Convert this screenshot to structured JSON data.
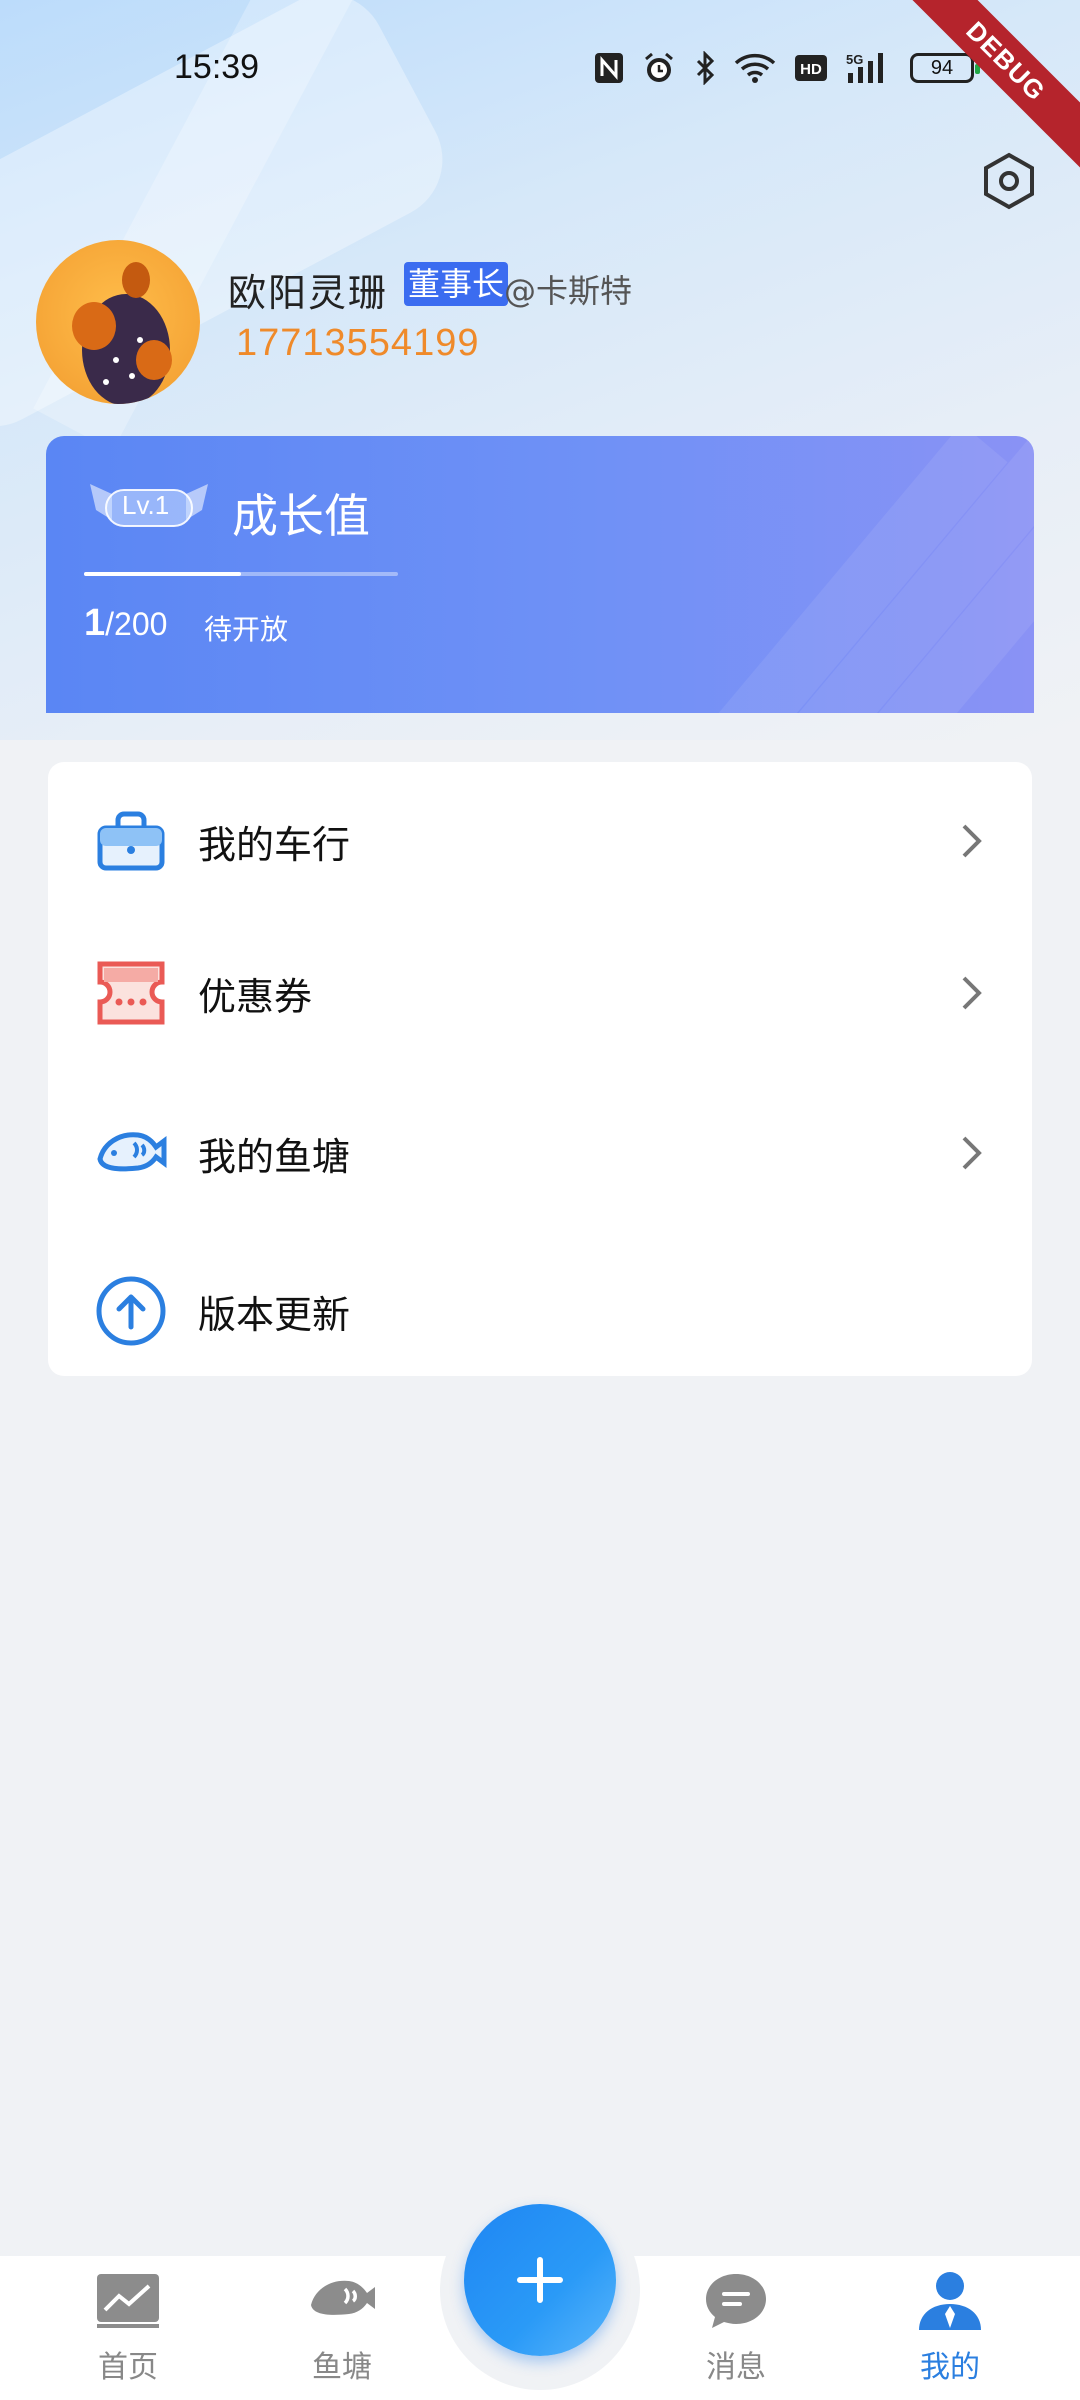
{
  "status_bar": {
    "time": "15:39",
    "network": "5G",
    "hd": "HD",
    "battery": "94"
  },
  "debug_banner": "DEBUG",
  "profile": {
    "name": "欧阳灵珊",
    "role": "董事长",
    "org": "@卡斯特",
    "phone": "17713554199"
  },
  "growth": {
    "level": "Lv.1",
    "title": "成长值",
    "current": "1",
    "total": "/200",
    "status": "待开放",
    "progress": 0.5
  },
  "menu": {
    "items": [
      {
        "label": "我的车行",
        "icon": "briefcase-icon"
      },
      {
        "label": "优惠券",
        "icon": "coupon-icon"
      },
      {
        "label": "我的鱼塘",
        "icon": "fish-icon"
      },
      {
        "label": "版本更新",
        "icon": "upload-arrow-icon"
      }
    ]
  },
  "bottom_nav": {
    "items": [
      {
        "label": "首页",
        "icon": "chart-icon"
      },
      {
        "label": "鱼塘",
        "icon": "fish-icon"
      },
      {
        "label": "消息",
        "icon": "message-icon"
      },
      {
        "label": "我的",
        "icon": "user-icon"
      }
    ],
    "active": "我的",
    "fab": "plus-icon"
  },
  "colors": {
    "accent": "#2b7fe0",
    "phone": "#ef8a2a",
    "role_badge": "#3b6cf0",
    "coupon": "#ea5a55"
  }
}
